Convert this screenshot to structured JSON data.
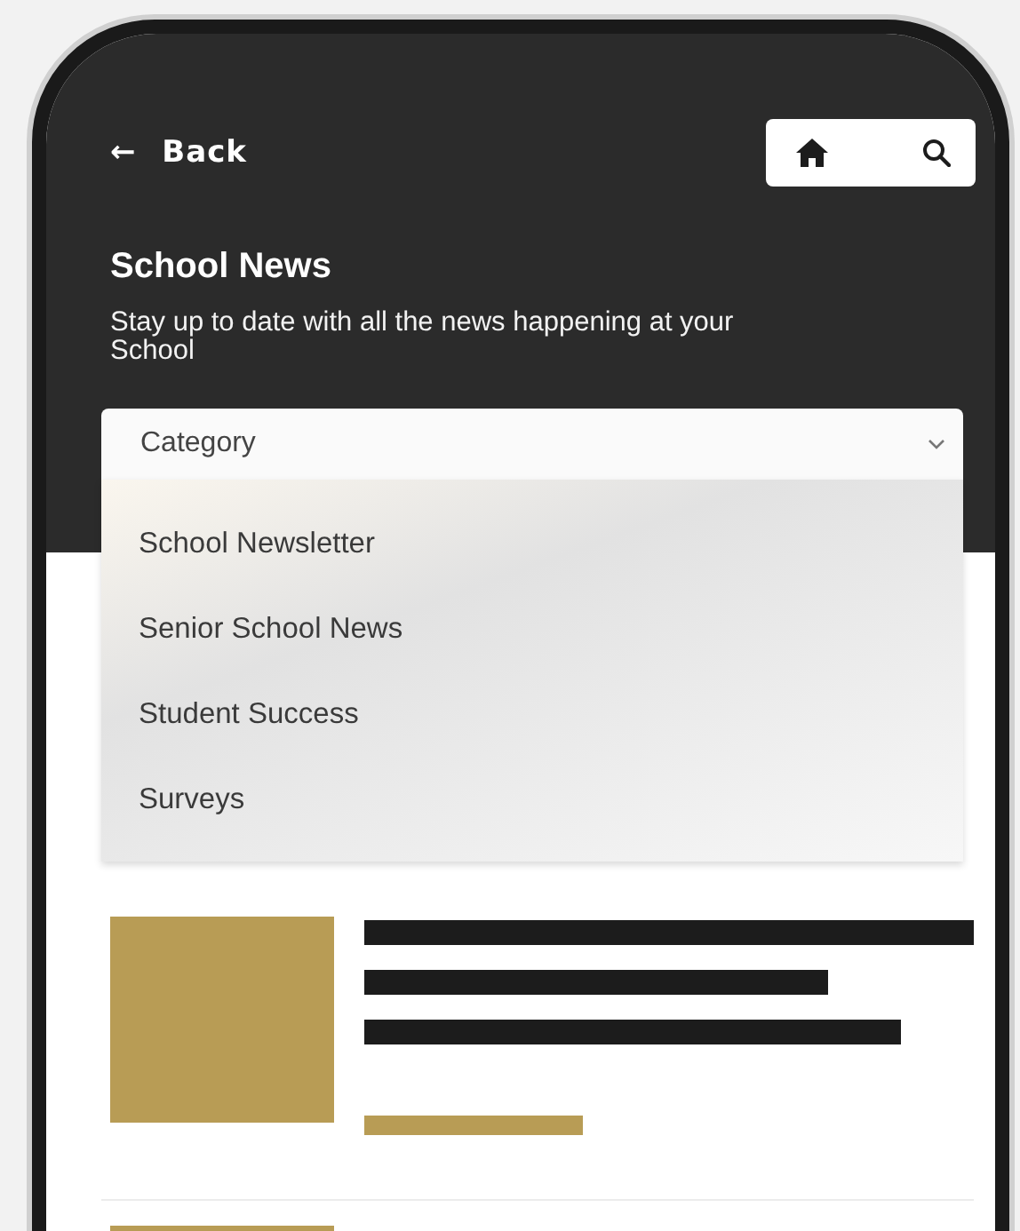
{
  "nav": {
    "back_arrow": "←",
    "back_label": "Back"
  },
  "header": {
    "title": "School News",
    "subtitle": "Stay up to date with all the news happening at your School"
  },
  "category_dropdown": {
    "placeholder": "Category",
    "expanded": true
  },
  "menu_items": [
    "School Newsletter",
    "Senior School News",
    "Student Success",
    "Surveys"
  ]
}
